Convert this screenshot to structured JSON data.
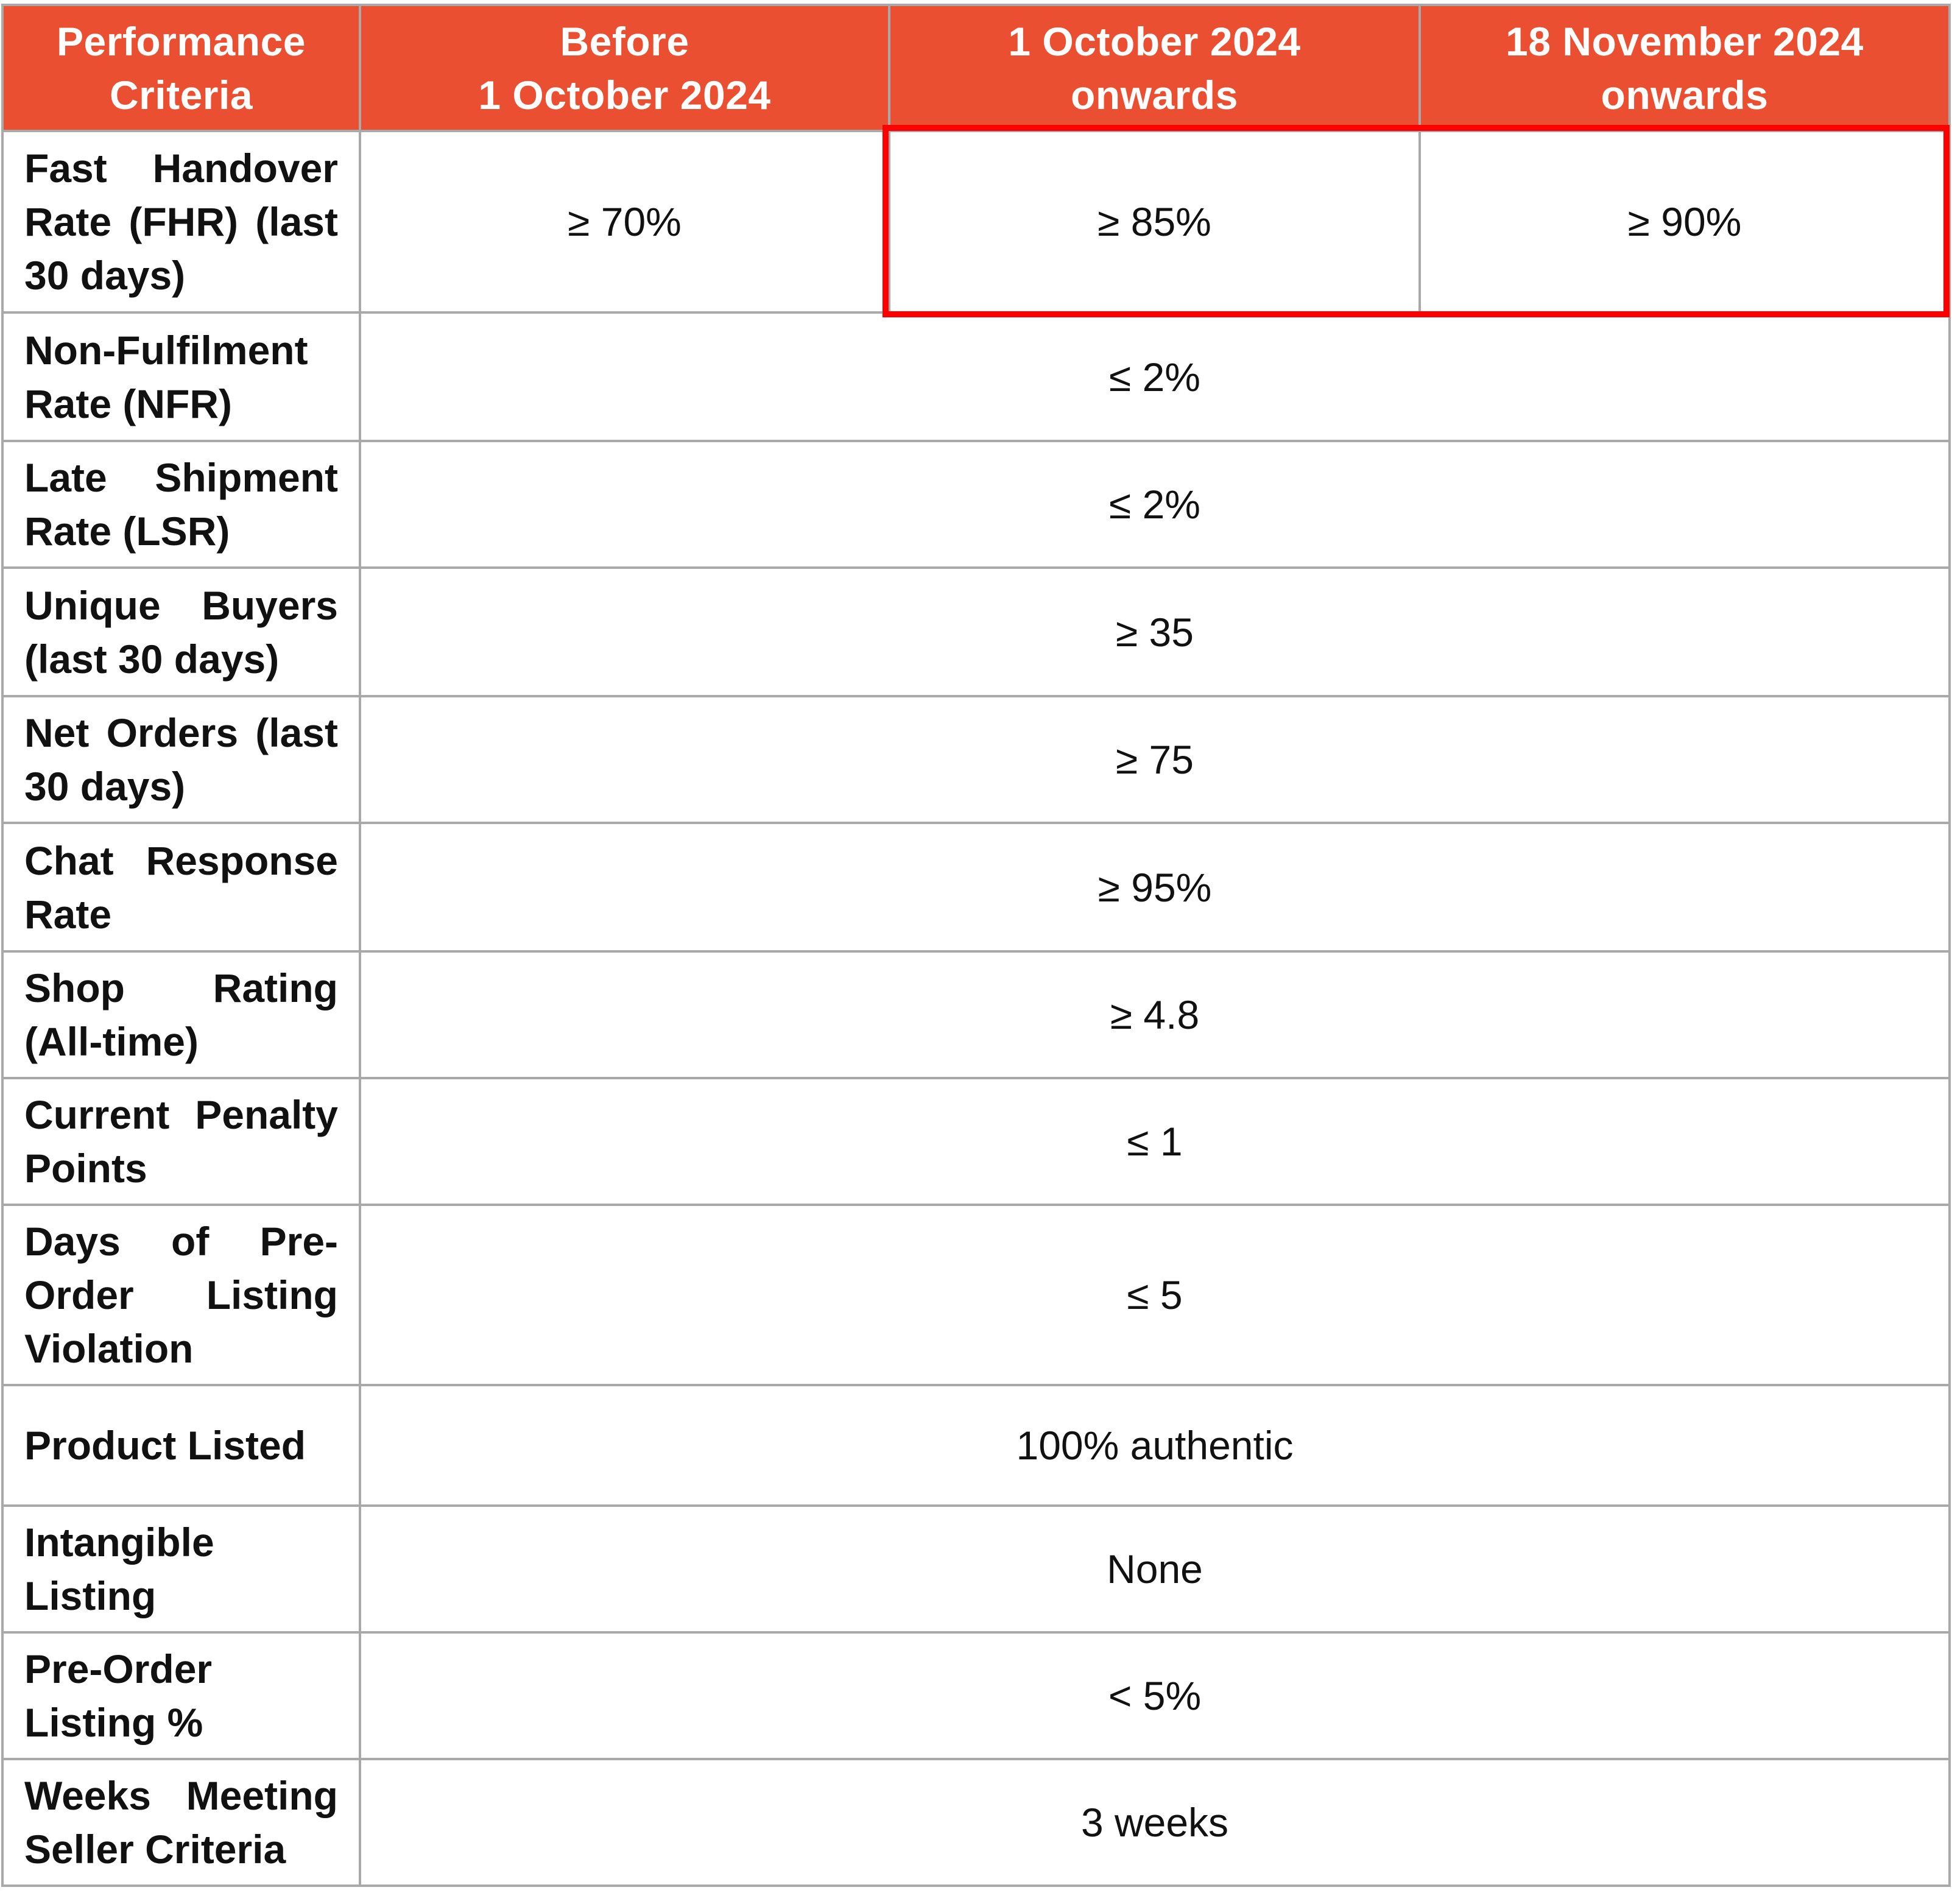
{
  "table": {
    "headers": [
      "Performance Criteria",
      "Before 1 October 2024",
      "1 October 2024 onwards",
      "18 November 2024 onwards"
    ],
    "header_lines": [
      [
        "Performance",
        "Criteria"
      ],
      [
        "Before",
        "1 October 2024"
      ],
      [
        "1 October 2024",
        "onwards"
      ],
      [
        "18 November 2024",
        "onwards"
      ]
    ],
    "rows": [
      {
        "criteria": "Fast Handover Rate (FHR) (last 30 days)",
        "before_1_oct_2024": "≥ 70%",
        "from_1_oct_2024": "≥ 85%",
        "from_18_nov_2024": "≥ 90%"
      },
      {
        "criteria": "Non-Fulfilment Rate (NFR)",
        "value": "≤ 2%"
      },
      {
        "criteria": "Late Shipment Rate (LSR)",
        "value": "≤ 2%"
      },
      {
        "criteria": "Unique Buyers (last 30 days)",
        "value": "≥ 35"
      },
      {
        "criteria": "Net Orders (last 30 days)",
        "value": "≥ 75"
      },
      {
        "criteria": "Chat Response Rate",
        "value": "≥ 95%"
      },
      {
        "criteria": "Shop Rating (All-time)",
        "value": "≥ 4.8"
      },
      {
        "criteria": "Current Penalty Points",
        "value": "≤ 1"
      },
      {
        "criteria": "Days of Pre-Order Listing Violation",
        "value": "≤ 5"
      },
      {
        "criteria": "Product Listed",
        "value": "100% authentic"
      },
      {
        "criteria": "Intangible Listing",
        "value": "None"
      },
      {
        "criteria": "Pre-Order Listing %",
        "value": "< 5%"
      },
      {
        "criteria": "Weeks Meeting Seller Criteria",
        "value": "3 weeks"
      }
    ]
  },
  "colors": {
    "header_bg": "#ea4f31",
    "header_text": "#ffffff",
    "highlight_border": "#ff0000",
    "grid_line": "#a9a9a9"
  }
}
